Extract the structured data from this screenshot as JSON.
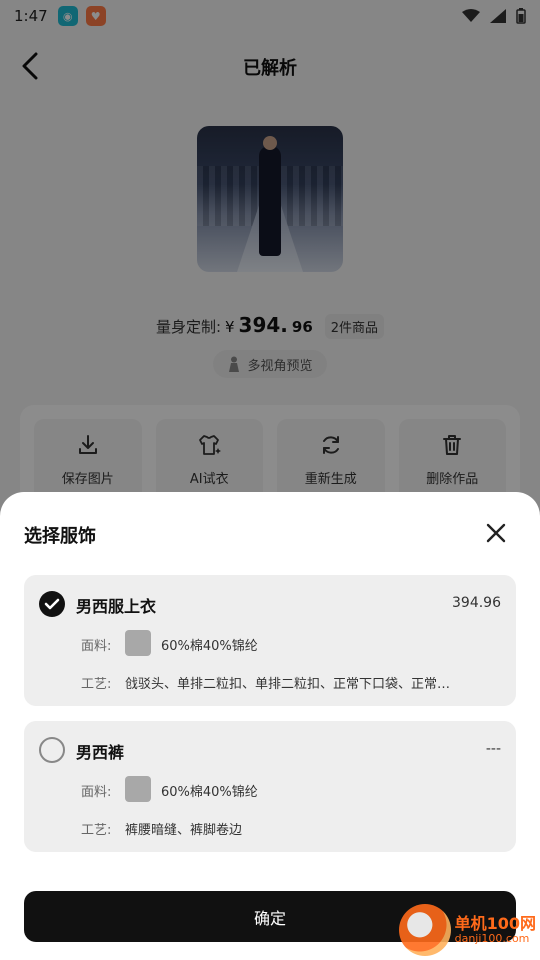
{
  "status_bar": {
    "time": "1:47"
  },
  "header": {
    "title": "已解析"
  },
  "product": {
    "price_label": "量身定制:",
    "currency": "¥",
    "price_int": "394.",
    "price_dec": "96",
    "item_count": "2件商品",
    "preview_label": "多视角预览"
  },
  "actions": [
    {
      "label": "保存图片",
      "icon": "download-icon"
    },
    {
      "label": "AI试衣",
      "icon": "shirt-sparkle-icon"
    },
    {
      "label": "重新生成",
      "icon": "refresh-icon"
    },
    {
      "label": "删除作品",
      "icon": "trash-icon"
    }
  ],
  "sheet": {
    "title": "选择服饰",
    "items": [
      {
        "name": "男西服上衣",
        "price": "394.96",
        "checked": true,
        "fabric_label": "面料:",
        "fabric_value": "60%棉40%锦纶",
        "craft_label": "工艺:",
        "craft_value": "戗驳头、单排二粒扣、单排二粒扣、正常下口袋、正常…"
      },
      {
        "name": "男西裤",
        "price": "---",
        "checked": false,
        "fabric_label": "面料:",
        "fabric_value": "60%棉40%锦纶",
        "craft_label": "工艺:",
        "craft_value": "裤腰暗缝、裤脚卷边"
      }
    ],
    "confirm_label": "确定"
  },
  "watermark": {
    "line1": "单机100网",
    "line2": "danji100.com"
  }
}
